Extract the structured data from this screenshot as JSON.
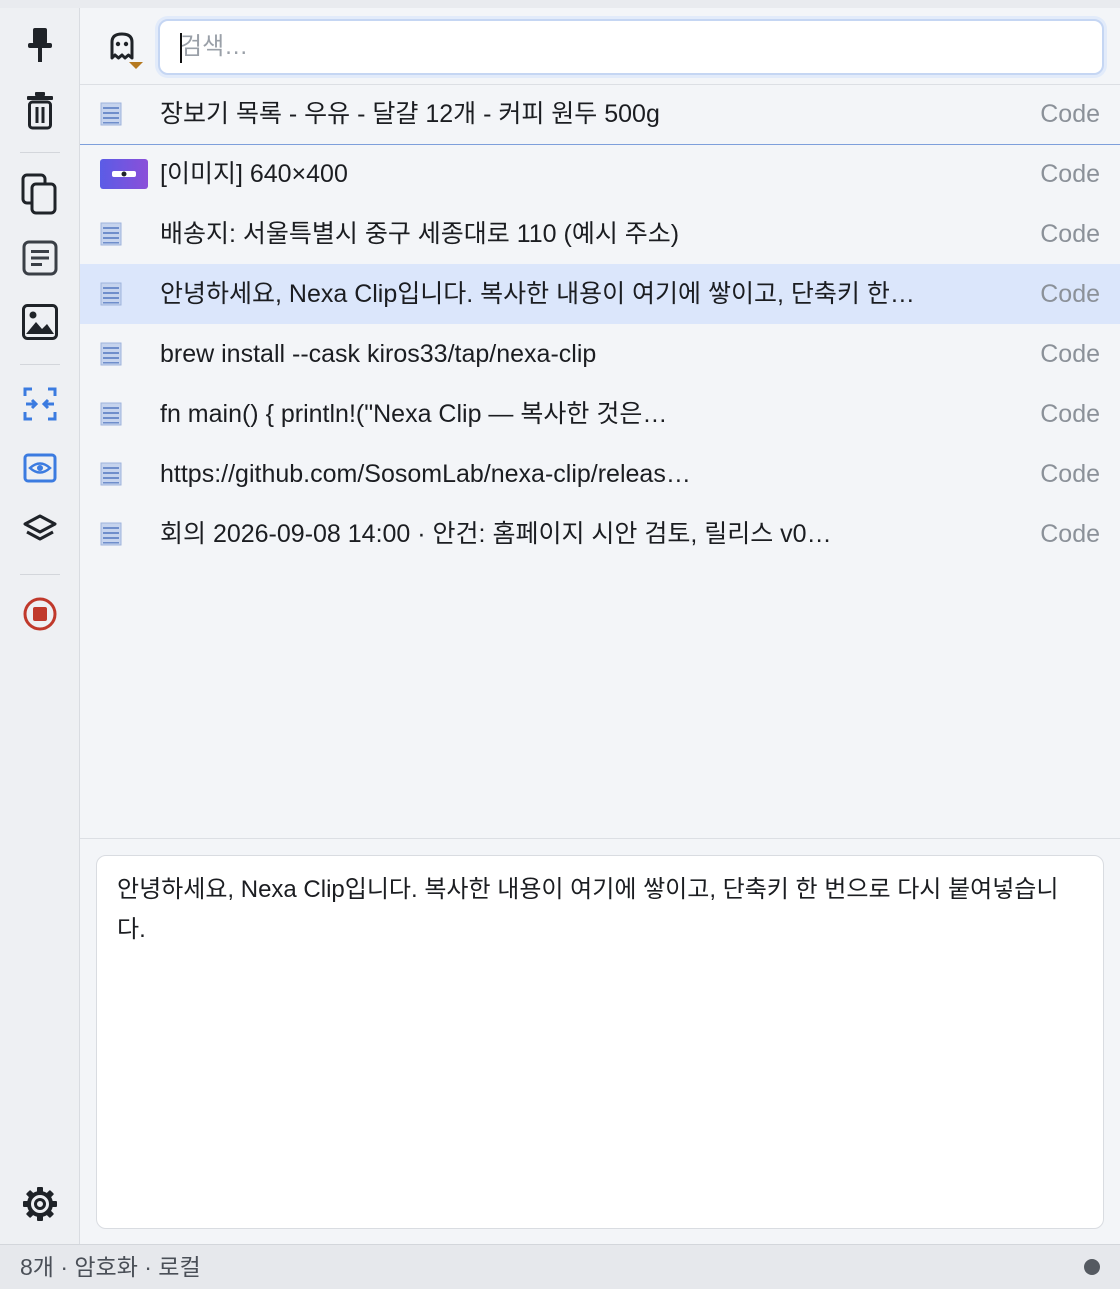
{
  "search": {
    "placeholder": "검색…",
    "value": ""
  },
  "toolbar": {
    "items": [
      {
        "icon": "pin-icon"
      },
      {
        "icon": "trash-icon"
      },
      {
        "icon": "copy-icon"
      },
      {
        "icon": "text-note-icon"
      },
      {
        "icon": "image-icon"
      },
      {
        "icon": "merge-icon"
      },
      {
        "icon": "eye-icon"
      },
      {
        "icon": "layers-icon"
      },
      {
        "icon": "stop-record-icon"
      },
      {
        "icon": "gear-icon"
      }
    ]
  },
  "clips": [
    {
      "type": "text",
      "icon": "text-clip-icon",
      "text": "장보기 목록 - 우유 - 달걀 12개 - 커피 원두 500g",
      "tag": "Code"
    },
    {
      "type": "image",
      "icon": "image-clip-icon",
      "text": "[이미지] 640×400",
      "tag": "Code"
    },
    {
      "type": "text",
      "icon": "text-clip-icon",
      "text": "배송지: 서울특별시 중구 세종대로 110 (예시 주소)",
      "tag": "Code"
    },
    {
      "type": "text",
      "icon": "text-clip-icon",
      "text": "안녕하세요, Nexa Clip입니다. 복사한 내용이 여기에 쌓이고, 단축키 한…",
      "tag": "Code",
      "selected": true
    },
    {
      "type": "text",
      "icon": "text-clip-icon",
      "text": "brew install --cask kiros33/tap/nexa-clip",
      "tag": "Code"
    },
    {
      "type": "text",
      "icon": "text-clip-icon",
      "text": "fn main() {     println!(\"Nexa Clip — 복사한 것은…",
      "tag": "Code"
    },
    {
      "type": "text",
      "icon": "text-clip-icon",
      "text": "https://github.com/SosomLab/nexa-clip/releas…",
      "tag": "Code"
    },
    {
      "type": "text",
      "icon": "text-clip-icon",
      "text": "회의 2026-09-08 14:00 · 안건: 홈페이지 시안 검토, 릴리스 v0…",
      "tag": "Code"
    }
  ],
  "preview": {
    "text": "안녕하세요, Nexa Clip입니다. 복사한 내용이 여기에 쌓이고, 단축키 한 번으로 다시 붙여넣습니다."
  },
  "status": {
    "text": "8개 · 암호화 · 로컬"
  },
  "colors": {
    "accent": "#3b7be0",
    "selected_row": "#dbe6fb",
    "record": "#c0392b"
  }
}
